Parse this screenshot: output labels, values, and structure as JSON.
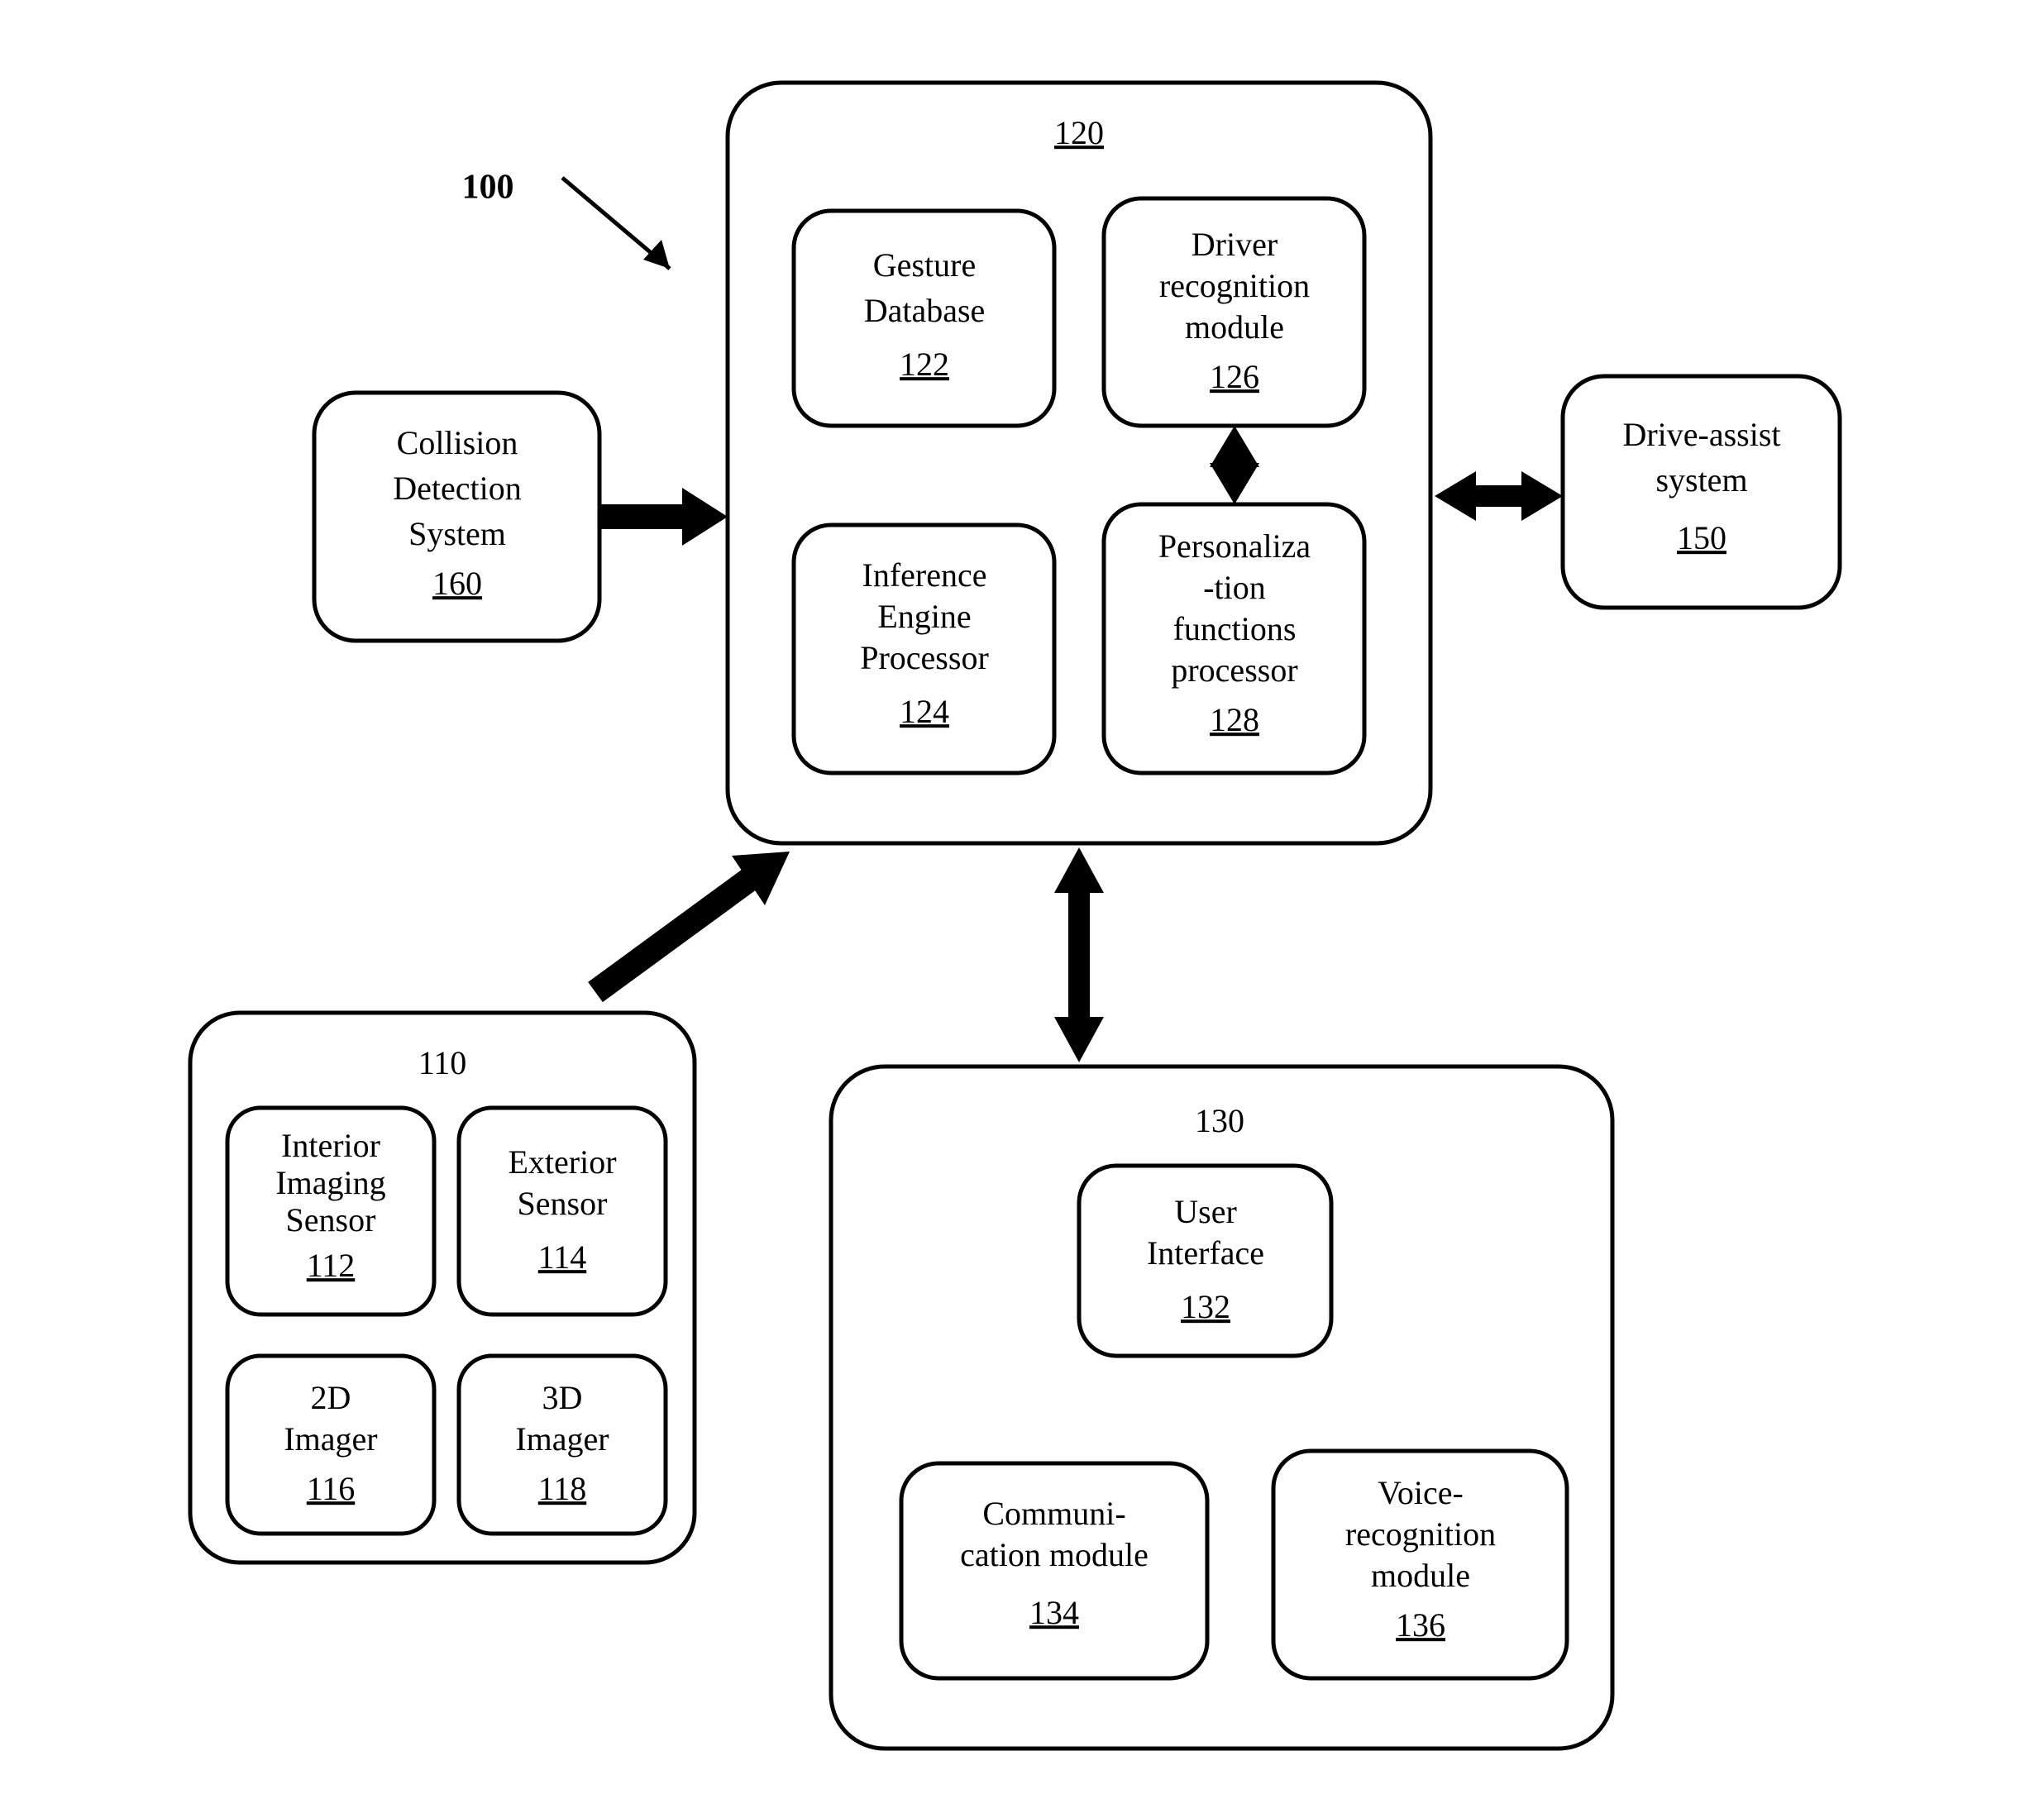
{
  "figure_ref": "100",
  "block160": {
    "line1": "Collision",
    "line2": "Detection",
    "line3": "System",
    "ref": "160"
  },
  "block120_ref": "120",
  "block122": {
    "line1": "Gesture",
    "line2": "Database",
    "ref": "122"
  },
  "block126": {
    "line1": "Driver",
    "line2": "recognition",
    "line3": "module",
    "ref": "126"
  },
  "block124": {
    "line1": "Inference",
    "line2": "Engine",
    "line3": "Processor",
    "ref": "124"
  },
  "block128": {
    "line1": "Personaliza",
    "line2": "-tion",
    "line3": "functions",
    "line4": "processor",
    "ref": "128"
  },
  "block150": {
    "line1": "Drive-assist",
    "line2": "system",
    "ref": "150"
  },
  "block110_ref": "110",
  "block112": {
    "line1": "Interior",
    "line2": "Imaging",
    "line3": "Sensor",
    "ref": "112"
  },
  "block114": {
    "line1": "Exterior",
    "line2": "Sensor",
    "ref": "114"
  },
  "block116": {
    "line1": "2D",
    "line2": "Imager",
    "ref": "116"
  },
  "block118": {
    "line1": "3D",
    "line2": "Imager",
    "ref": "118"
  },
  "block130_ref": "130",
  "block132": {
    "line1": "User",
    "line2": "Interface",
    "ref": "132"
  },
  "block134": {
    "line1": "Communi-",
    "line2": "cation module",
    "ref": "134"
  },
  "block136": {
    "line1": "Voice-",
    "line2": "recognition",
    "line3": "module",
    "ref": "136"
  }
}
